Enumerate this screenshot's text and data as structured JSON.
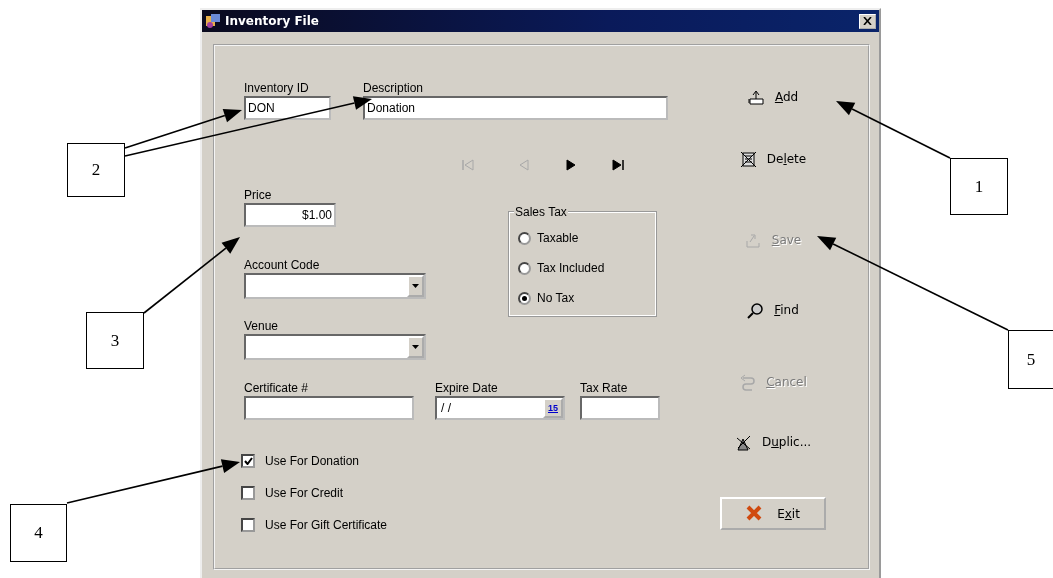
{
  "window": {
    "title": "Inventory File"
  },
  "id_fields": [
    {
      "label": "Inventory ID",
      "value": "DON",
      "kind": "short"
    },
    {
      "label": "Description",
      "value": "Donation",
      "kind": "long"
    }
  ],
  "record_nav": [
    {
      "kind": "first",
      "disabled": true
    },
    {
      "kind": "previous",
      "disabled": true
    },
    {
      "kind": "next",
      "disabled": false
    },
    {
      "kind": "last",
      "disabled": false
    }
  ],
  "price": {
    "label": "Price",
    "value": "$1.00"
  },
  "dropdowns": [
    {
      "label": "Account Code"
    },
    {
      "label": "Venue"
    }
  ],
  "sales_tax": {
    "title": "Sales Tax",
    "options": [
      {
        "label": "Taxable",
        "selected": false
      },
      {
        "label": "Tax Included",
        "selected": false
      },
      {
        "label": "No Tax",
        "selected": true
      }
    ]
  },
  "certificate": {
    "label": "Certificate #"
  },
  "expire_date": {
    "label": "Expire Date",
    "value": " / /",
    "calendar_label": "15"
  },
  "tax_rate": {
    "label": "Tax Rate"
  },
  "options": [
    {
      "label": "Use For Donation",
      "checked": true
    },
    {
      "label": "Use For Credit",
      "checked": false
    },
    {
      "label": "Use For Gift Certificate",
      "checked": false
    }
  ],
  "actions": [
    {
      "hotkey": "A",
      "label_end": "dd",
      "kind": "add",
      "disabled": false
    },
    {
      "label_start": "De",
      "hotkey": "l",
      "label_end": "ete",
      "kind": "delete",
      "disabled": false
    },
    {
      "hotkey": "S",
      "label_end": "ave",
      "kind": "save",
      "disabled": true
    },
    {
      "hotkey": "F",
      "label_end": "ind",
      "kind": "find",
      "disabled": false
    },
    {
      "hotkey": "C",
      "label_end": "ancel",
      "kind": "cancel",
      "disabled": true
    },
    {
      "label_start": "D",
      "hotkey": "u",
      "label_end": "plic...",
      "kind": "duplicate",
      "disabled": false
    },
    {
      "label_start": "E",
      "hotkey": "x",
      "label_end": "it",
      "kind": "exit",
      "disabled": false
    }
  ],
  "callouts": [
    {
      "number": "1"
    },
    {
      "number": "2"
    },
    {
      "number": "3"
    },
    {
      "number": "4"
    },
    {
      "number": "5"
    }
  ]
}
